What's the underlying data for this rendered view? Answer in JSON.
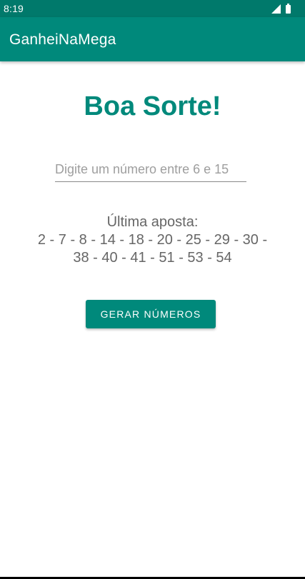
{
  "status_bar": {
    "time": "8:19",
    "icons": [
      "signal-icon",
      "battery-icon"
    ]
  },
  "app_bar": {
    "title": "GanheiNaMega"
  },
  "main": {
    "headline": "Boa Sorte!",
    "number_input": {
      "value": "",
      "placeholder": "Digite um número entre 6 e 15"
    },
    "last_bet": {
      "label": "Última aposta:",
      "numbers_line_1": "2 - 7 - 8 - 14 - 18 - 20 - 25 - 29 - 30 -",
      "numbers_line_2": "38 - 40 - 41 - 51 - 53 - 54"
    },
    "generate_button_label": "GERAR NÚMEROS"
  },
  "colors": {
    "primary": "#00897b",
    "primary_dark": "#00796b",
    "text_secondary": "#666666"
  }
}
